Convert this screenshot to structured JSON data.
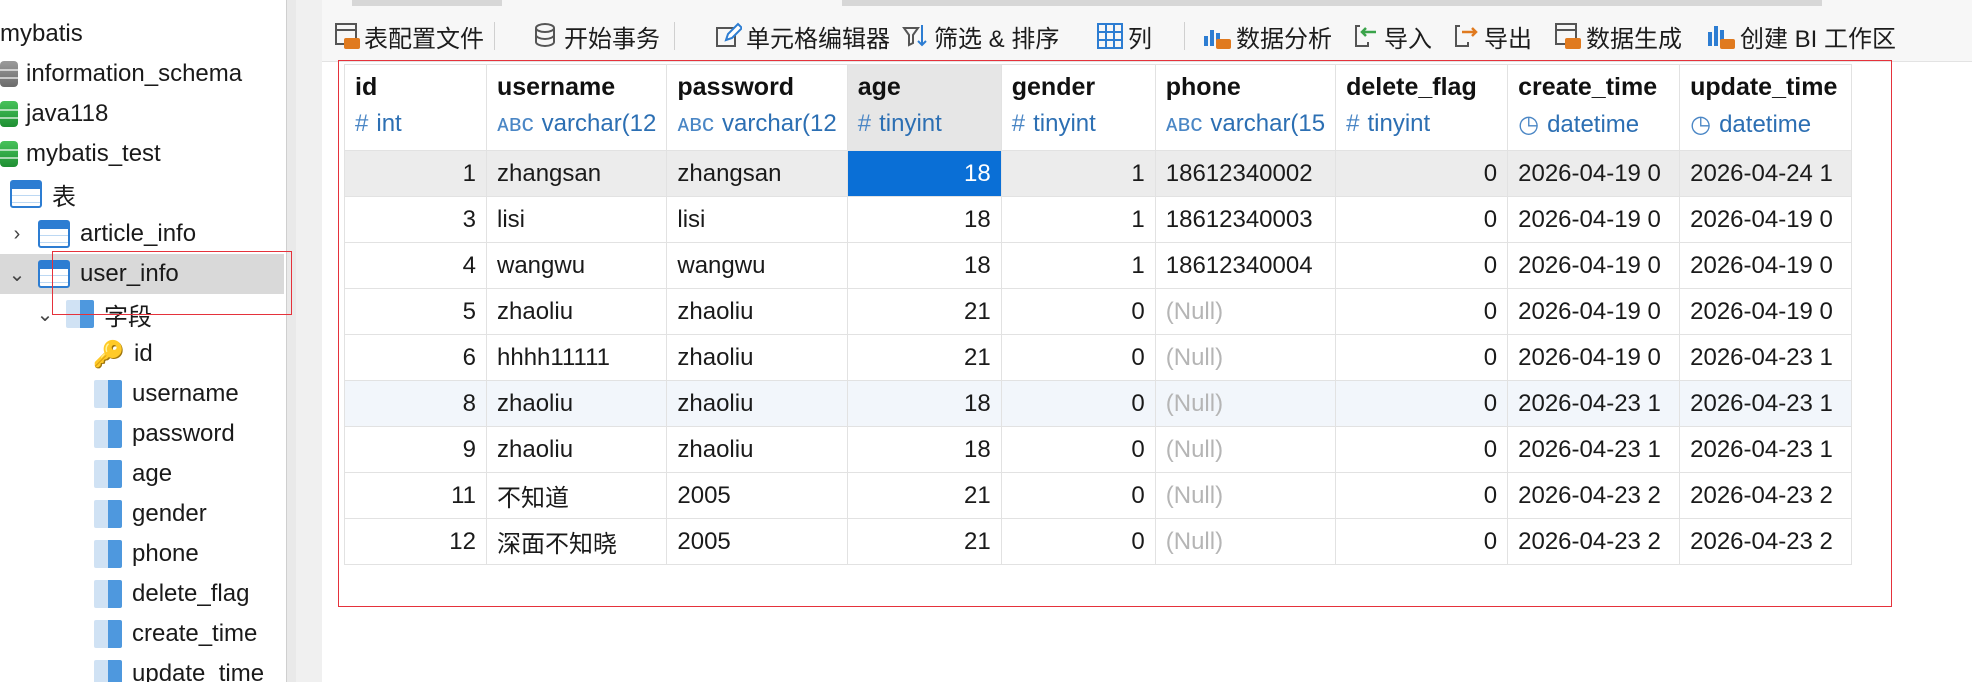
{
  "sidebar": {
    "items": [
      {
        "label": "mybatis",
        "kind": "db-partial"
      },
      {
        "label": "information_schema",
        "kind": "db-gray"
      },
      {
        "label": "java118",
        "kind": "db-green"
      },
      {
        "label": "mybatis_test",
        "kind": "db-green"
      },
      {
        "label": "表",
        "kind": "tables-folder"
      },
      {
        "label": "article_info",
        "kind": "table"
      },
      {
        "label": "user_info",
        "kind": "table",
        "selected": true
      },
      {
        "label": "字段",
        "kind": "fields-folder"
      },
      {
        "label": "id",
        "kind": "key"
      },
      {
        "label": "username",
        "kind": "column"
      },
      {
        "label": "password",
        "kind": "column"
      },
      {
        "label": "age",
        "kind": "column"
      },
      {
        "label": "gender",
        "kind": "column"
      },
      {
        "label": "phone",
        "kind": "column"
      },
      {
        "label": "delete_flag",
        "kind": "column"
      },
      {
        "label": "create_time",
        "kind": "column"
      },
      {
        "label": "update_time",
        "kind": "column"
      }
    ]
  },
  "toolbar": {
    "items": [
      {
        "label": "表配置文件",
        "icon": "table-config-icon"
      },
      {
        "label": "开始事务",
        "icon": "database-transaction-icon"
      },
      {
        "label": "单元格编辑器",
        "icon": "pencil-edit-icon"
      },
      {
        "label": "筛选 & 排序",
        "icon": "filter-sort-icon"
      },
      {
        "label": "列",
        "icon": "columns-grid-icon"
      },
      {
        "label": "数据分析",
        "icon": "bar-chart-icon"
      },
      {
        "label": "导入",
        "icon": "import-icon"
      },
      {
        "label": "导出",
        "icon": "export-icon"
      },
      {
        "label": "数据生成",
        "icon": "data-generate-icon"
      },
      {
        "label": "创建 BI 工作区",
        "icon": "bi-workspace-icon"
      }
    ]
  },
  "grid": {
    "columns": [
      {
        "name": "id",
        "type": "int",
        "type_icon": "#"
      },
      {
        "name": "username",
        "type": "varchar(12",
        "type_icon": "ABC"
      },
      {
        "name": "password",
        "type": "varchar(12",
        "type_icon": "ABC"
      },
      {
        "name": "age",
        "type": "tinyint",
        "type_icon": "#"
      },
      {
        "name": "gender",
        "type": "tinyint",
        "type_icon": "#"
      },
      {
        "name": "phone",
        "type": "varchar(15",
        "type_icon": "ABC"
      },
      {
        "name": "delete_flag",
        "type": "tinyint",
        "type_icon": "#"
      },
      {
        "name": "create_time",
        "type": "datetime",
        "type_icon": "clock"
      },
      {
        "name": "update_time",
        "type": "datetime",
        "type_icon": "clock"
      }
    ],
    "rows": [
      [
        "1",
        "zhangsan",
        "zhangsan",
        "18",
        "1",
        "18612340002",
        "0",
        "2026-04-19 0",
        "2026-04-24 1"
      ],
      [
        "3",
        "lisi",
        "lisi",
        "18",
        "1",
        "18612340003",
        "0",
        "2026-04-19 0",
        "2026-04-19 0"
      ],
      [
        "4",
        "wangwu",
        "wangwu",
        "18",
        "1",
        "18612340004",
        "0",
        "2026-04-19 0",
        "2026-04-19 0"
      ],
      [
        "5",
        "zhaoliu",
        "zhaoliu",
        "21",
        "0",
        "(Null)",
        "0",
        "2026-04-19 0",
        "2026-04-19 0"
      ],
      [
        "6",
        "hhhh11111",
        "zhaoliu",
        "21",
        "0",
        "(Null)",
        "0",
        "2026-04-19 0",
        "2026-04-23 1"
      ],
      [
        "8",
        "zhaoliu",
        "zhaoliu",
        "18",
        "0",
        "(Null)",
        "0",
        "2026-04-23 1",
        "2026-04-23 1"
      ],
      [
        "9",
        "zhaoliu",
        "zhaoliu",
        "18",
        "0",
        "(Null)",
        "0",
        "2026-04-23 1",
        "2026-04-23 1"
      ],
      [
        "11",
        "不知道",
        "2005",
        "21",
        "0",
        "(Null)",
        "0",
        "2026-04-23 2",
        "2026-04-23 2"
      ],
      [
        "12",
        "深面不知晓",
        "2005",
        "21",
        "0",
        "(Null)",
        "0",
        "2026-04-23 2",
        "2026-04-23 2"
      ]
    ],
    "selected_cell": {
      "row": 0,
      "col": 3
    }
  },
  "colors": {
    "selection": "#0a6fd6",
    "type_text": "#2c6fb3",
    "annotation": "#e5323b",
    "null_text": "#b5b5b5"
  }
}
